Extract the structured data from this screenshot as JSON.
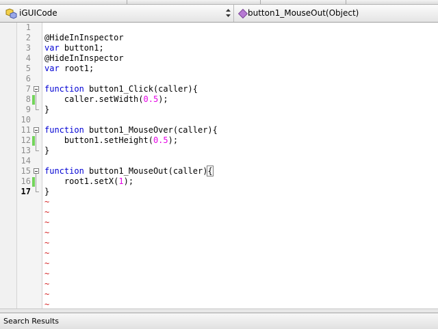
{
  "navigation": {
    "class_name": "iGUICode",
    "class_icon": "class-icon",
    "method_name": "button1_MouseOut(Object)",
    "method_icon": "method-icon"
  },
  "editor": {
    "current_line": 17,
    "lines": [
      {
        "n": "1",
        "parts": []
      },
      {
        "n": "2",
        "parts": [
          {
            "t": "@HideInInspector"
          }
        ]
      },
      {
        "n": "3",
        "parts": [
          {
            "t": "var",
            "k": "kw"
          },
          {
            "t": " button1;"
          }
        ]
      },
      {
        "n": "4",
        "parts": [
          {
            "t": "@HideInInspector"
          }
        ]
      },
      {
        "n": "5",
        "parts": [
          {
            "t": "var",
            "k": "kw"
          },
          {
            "t": " root1;"
          }
        ]
      },
      {
        "n": "6",
        "parts": []
      },
      {
        "n": "7",
        "parts": [
          {
            "t": "function",
            "k": "kw"
          },
          {
            "t": " button1_Click(caller){"
          }
        ]
      },
      {
        "n": "8",
        "parts": [
          {
            "t": "    caller.setWidth("
          },
          {
            "t": "0.5",
            "k": "num"
          },
          {
            "t": ");"
          }
        ]
      },
      {
        "n": "9",
        "parts": [
          {
            "t": "}"
          }
        ]
      },
      {
        "n": "10",
        "parts": []
      },
      {
        "n": "11",
        "parts": [
          {
            "t": "function",
            "k": "kw"
          },
          {
            "t": " button1_MouseOver(caller){"
          }
        ]
      },
      {
        "n": "12",
        "parts": [
          {
            "t": "    button1.setHeight("
          },
          {
            "t": "0.5",
            "k": "num"
          },
          {
            "t": ");"
          }
        ]
      },
      {
        "n": "13",
        "parts": [
          {
            "t": "}"
          }
        ]
      },
      {
        "n": "14",
        "parts": []
      },
      {
        "n": "15",
        "parts": [
          {
            "t": "function",
            "k": "kw"
          },
          {
            "t": " button1_MouseOut(caller)"
          },
          {
            "t": "{",
            "k": "caret"
          }
        ]
      },
      {
        "n": "16",
        "parts": [
          {
            "t": "    root1.setX("
          },
          {
            "t": "1",
            "k": "num"
          },
          {
            "t": ");"
          }
        ]
      },
      {
        "n": "17",
        "parts": [
          {
            "t": "}"
          }
        ]
      }
    ],
    "empty_line_marker": "~",
    "empty_line_count": 11,
    "fold_start_lines": [
      7,
      11,
      15
    ],
    "changed_lines": [
      8,
      12,
      16
    ]
  },
  "status_bar": {
    "label": "Search Results"
  },
  "colors": {
    "keyword": "#0000d4",
    "number": "#e500e5",
    "tilde": "#d42020",
    "change_marker": "#72d45a"
  }
}
